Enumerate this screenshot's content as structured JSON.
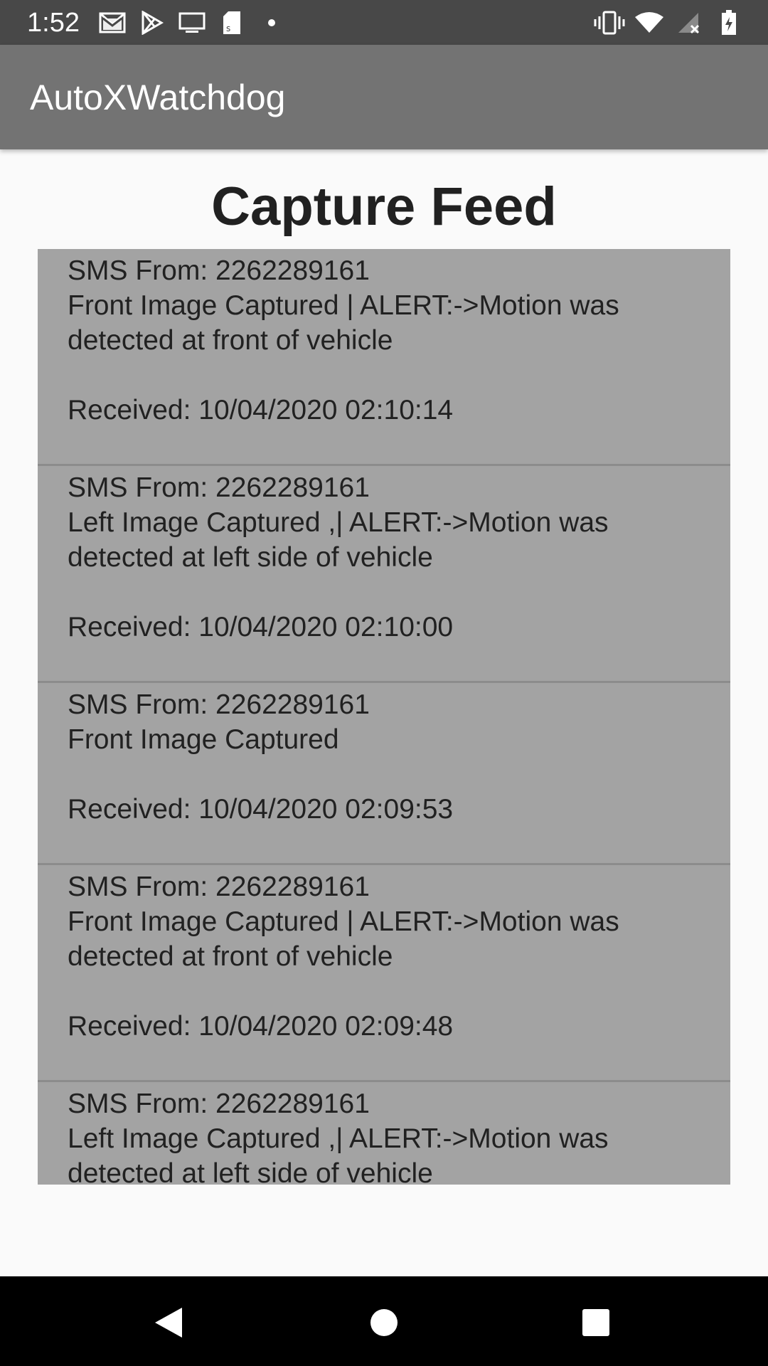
{
  "status_bar": {
    "time": "1:52",
    "left_icons": [
      "gmail-icon",
      "play-store-icon",
      "cast-screen-icon",
      "sim-card-icon",
      "dot-icon"
    ],
    "right_icons": [
      "vibrate-icon",
      "wifi-icon",
      "signal-icon",
      "battery-charging-icon"
    ]
  },
  "app_bar": {
    "title": "AutoXWatchdog"
  },
  "page": {
    "title": "Capture Feed"
  },
  "feed": {
    "items": [
      {
        "from": "SMS From: 2262289161",
        "message": "Front Image Captured | ALERT:->Motion was detected at front of vehicle",
        "received": "Received: 10/04/2020 02:10:14"
      },
      {
        "from": "SMS From: 2262289161",
        "message": "Left Image Captured ,| ALERT:->Motion was detected at left side of vehicle",
        "received": "Received: 10/04/2020 02:10:00"
      },
      {
        "from": "SMS From: 2262289161",
        "message": "Front Image Captured",
        "received": "Received: 10/04/2020 02:09:53"
      },
      {
        "from": "SMS From: 2262289161",
        "message": "Front Image Captured | ALERT:->Motion was detected at front of vehicle",
        "received": "Received: 10/04/2020 02:09:48"
      },
      {
        "from": "SMS From: 2262289161",
        "message": "Left Image Captured ,| ALERT:->Motion was detected at left side of vehicle",
        "received": ""
      }
    ]
  },
  "colors": {
    "status_bar": "#484848",
    "app_bar": "#737373",
    "feed_bg": "#a3a3a3",
    "divider": "#8c8c8c",
    "nav_bar": "#000000"
  },
  "nav_bar": {
    "icons": [
      "back-icon",
      "home-icon",
      "recents-icon"
    ]
  }
}
